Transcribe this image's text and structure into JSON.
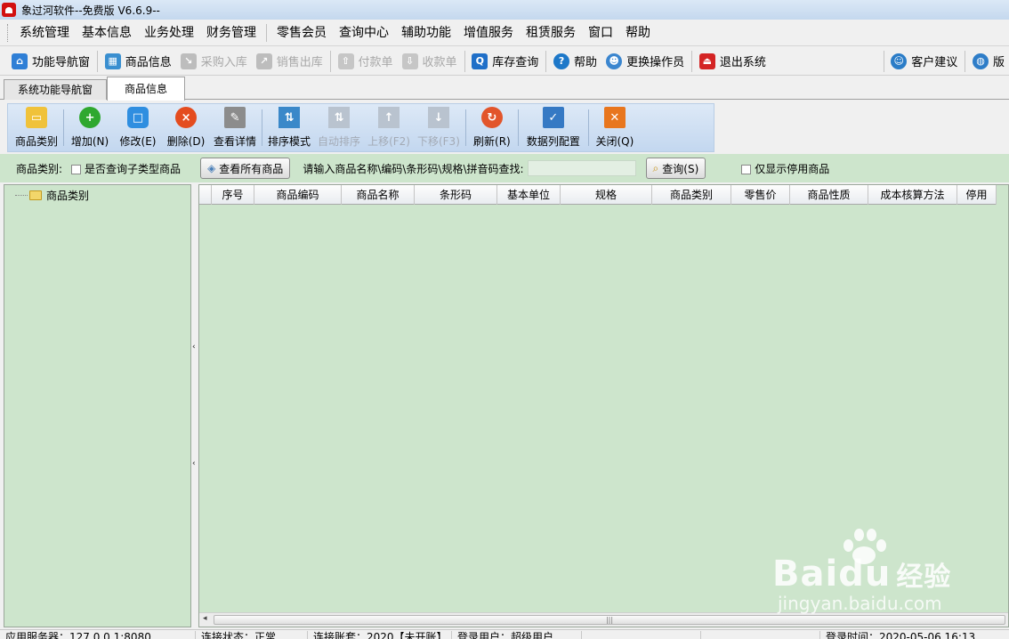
{
  "window": {
    "title": "象过河软件--免费版 V6.6.9--"
  },
  "menu": [
    "系统管理",
    "基本信息",
    "业务处理",
    "财务管理",
    "零售会员",
    "查询中心",
    "辅助功能",
    "增值服务",
    "租赁服务",
    "窗口",
    "帮助"
  ],
  "toolbar": {
    "nav": "功能导航窗",
    "product": "商品信息",
    "purchase_in": "采购入库",
    "sales_out": "销售出库",
    "payment": "付款单",
    "receipt": "收款单",
    "stock_query": "库存查询",
    "help": "帮助",
    "change_operator": "更换操作员",
    "exit": "退出系统",
    "feedback": "客户建议",
    "version": "版"
  },
  "tabs": [
    "系统功能导航窗",
    "商品信息"
  ],
  "ribbon": {
    "category": "商品类别",
    "add": "增加(N)",
    "edit": "修改(E)",
    "delete": "删除(D)",
    "detail": "查看详情",
    "sort_mode": "排序模式",
    "auto_sort": "自动排序",
    "move_up": "上移(F2)",
    "move_down": "下移(F3)",
    "refresh": "刷新(R)",
    "columns": "数据列配置",
    "close": "关闭(Q)"
  },
  "filter": {
    "category_label": "商品类别:",
    "include_sub": "是否查询子类型商品",
    "view_all": "查看所有商品",
    "search_label": "请输入商品名称\\编码\\条形码\\规格\\拼音码查找:",
    "search_value": "",
    "query": "查询(S)",
    "only_disabled": "仅显示停用商品"
  },
  "tree": {
    "root": "商品类别"
  },
  "grid": {
    "columns": [
      "",
      "序号",
      "商品编码",
      "商品名称",
      "条形码",
      "基本单位",
      "规格",
      "商品类别",
      "零售价",
      "商品性质",
      "成本核算方法",
      "停用"
    ]
  },
  "status": {
    "server": "应用服务器：127.0.0.1:8080",
    "connection": "连接状态：正常",
    "account": "连接账套：2020【未开账】",
    "user": "登录用户：超级用户",
    "login_time": "登录时间：2020-05-06 16:13"
  },
  "watermark": {
    "brand": "Bai",
    "brand2": "du",
    "cn": "经验",
    "url": "jingyan.baidu.com"
  }
}
